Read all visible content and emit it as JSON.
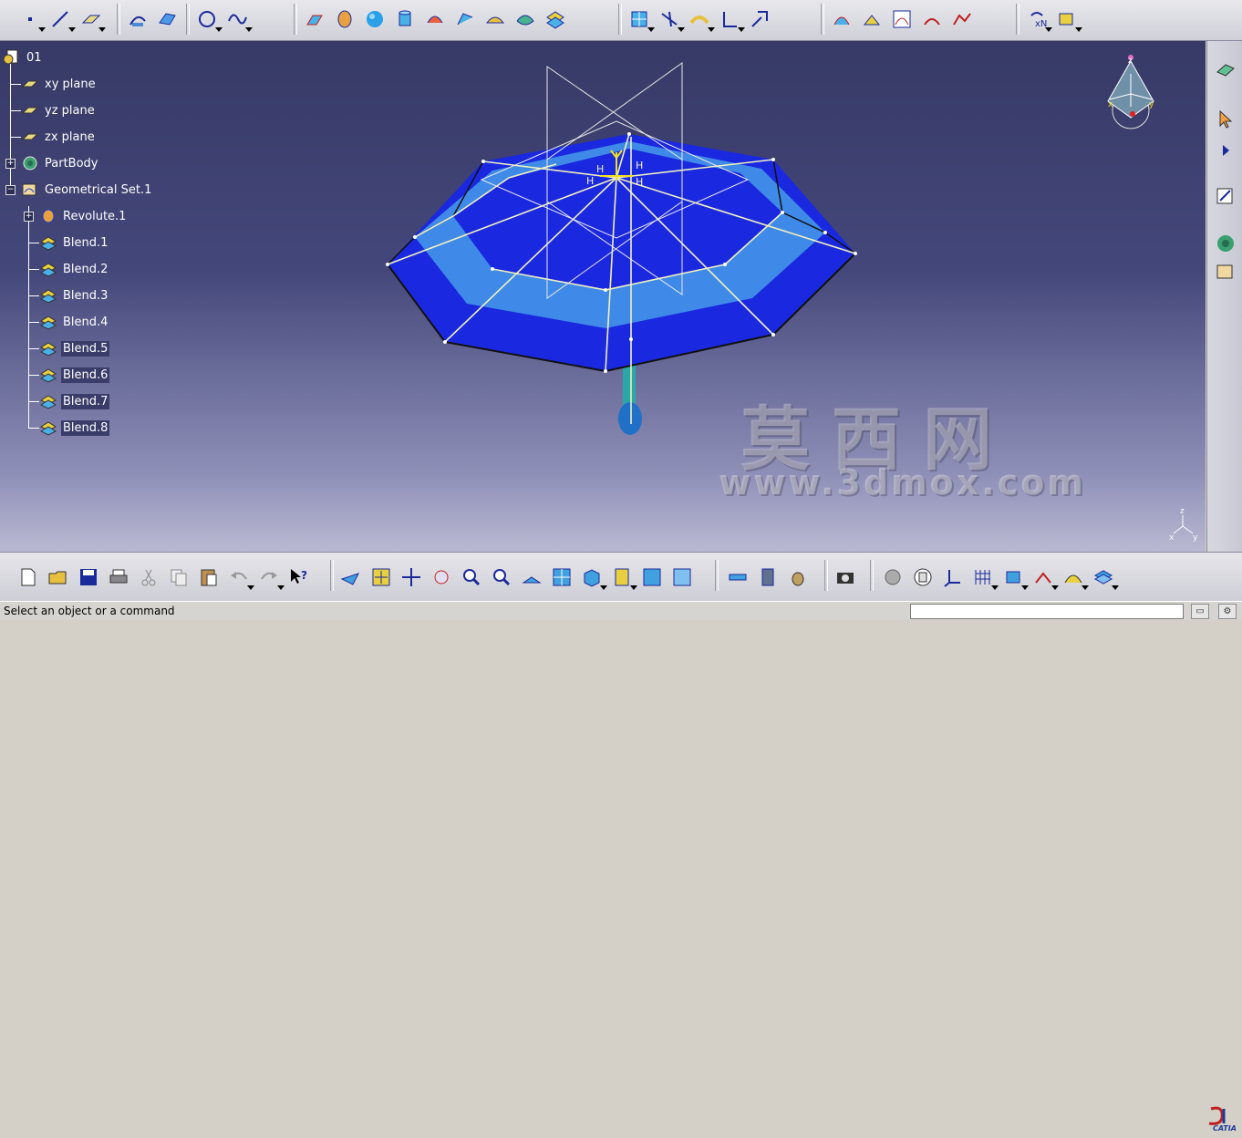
{
  "tree": {
    "root": "01",
    "items": [
      {
        "label": "xy plane",
        "icon": "plane-icon"
      },
      {
        "label": "yz plane",
        "icon": "plane-icon"
      },
      {
        "label": "zx plane",
        "icon": "plane-icon"
      },
      {
        "label": "PartBody",
        "icon": "partbody-icon"
      },
      {
        "label": "Geometrical Set.1",
        "icon": "geometrical-set-icon"
      },
      {
        "label": "Revolute.1",
        "icon": "revolute-icon"
      },
      {
        "label": "Blend.1",
        "icon": "blend-icon"
      },
      {
        "label": "Blend.2",
        "icon": "blend-icon"
      },
      {
        "label": "Blend.3",
        "icon": "blend-icon"
      },
      {
        "label": "Blend.4",
        "icon": "blend-icon"
      },
      {
        "label": "Blend.5",
        "icon": "blend-icon"
      },
      {
        "label": "Blend.6",
        "icon": "blend-icon"
      },
      {
        "label": "Blend.7",
        "icon": "blend-icon"
      },
      {
        "label": "Blend.8",
        "icon": "blend-icon"
      }
    ]
  },
  "watermark": {
    "cn": "莫西网",
    "url": "www.3dmox.com"
  },
  "status": {
    "message": "Select an object or a command"
  },
  "compass": {
    "z": "z",
    "x": "x",
    "y": "y"
  },
  "axis_triad": {
    "z": "z",
    "x": "x",
    "y": "y"
  },
  "brand": {
    "logo_text": "CATIA"
  },
  "colors": {
    "viewport_top": "#373a66",
    "viewport_bottom": "#b9b9d2",
    "umbrella_dark": "#1a28e0",
    "umbrella_light": "#3f8ae8",
    "handle": "#2aa8a8"
  }
}
